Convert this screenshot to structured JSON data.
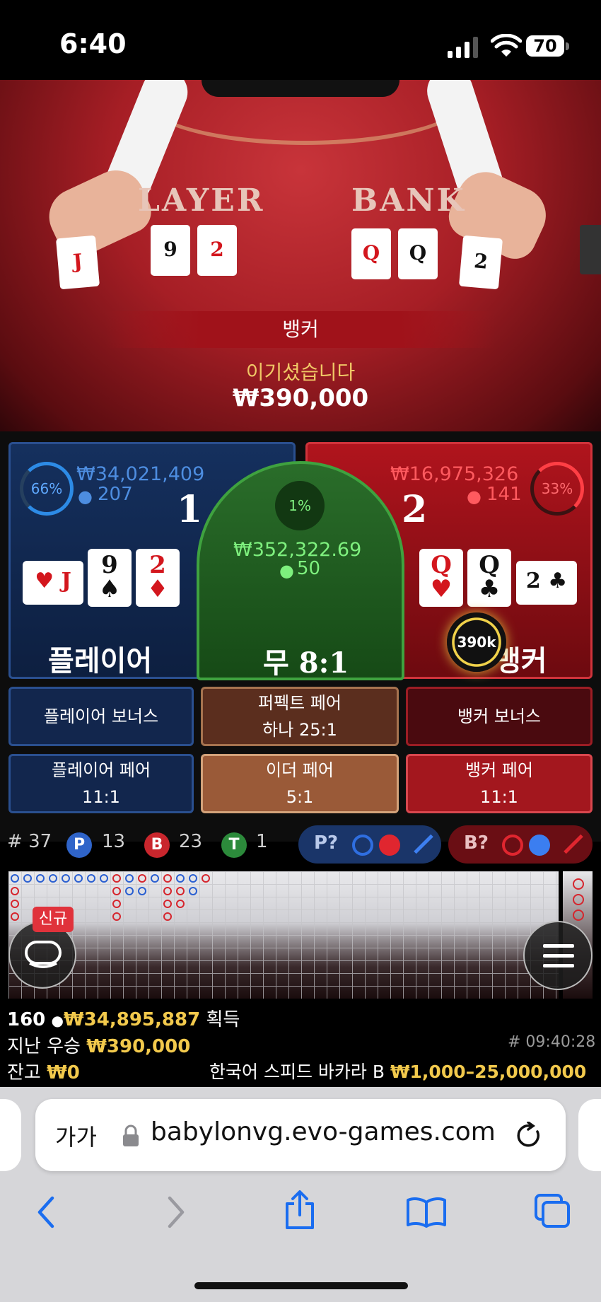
{
  "status_bar": {
    "time": "6:40",
    "battery": "70"
  },
  "video": {
    "table_labels": [
      "LAYER",
      "BANK"
    ],
    "player_cards": [
      "J",
      "9",
      "2"
    ],
    "banker_cards": [
      "Q",
      "Q",
      "2"
    ],
    "result": {
      "winner": "뱅커",
      "message": "이기셨습니다",
      "amount": "₩390,000"
    }
  },
  "player": {
    "percent": "66%",
    "amount": "₩34,021,409",
    "count": "207",
    "score": "1",
    "name": "플레이어",
    "cards": [
      {
        "rank": "J",
        "suit": "♥"
      },
      {
        "rank": "9",
        "suit": "♠"
      },
      {
        "rank": "2",
        "suit": "♦"
      }
    ]
  },
  "tie": {
    "percent": "1%",
    "amount": "₩352,322.69",
    "count": "50",
    "label": "무",
    "odds": "8:1"
  },
  "banker": {
    "percent": "33%",
    "amount": "₩16,975,326",
    "count": "141",
    "score": "2",
    "name": "뱅커",
    "cards": [
      {
        "rank": "Q",
        "suit": "♥"
      },
      {
        "rank": "Q",
        "suit": "♣"
      },
      {
        "rank": "2",
        "suit": "♣"
      }
    ],
    "chip": "390k"
  },
  "side_bets": {
    "player_bonus": "플레이어 보너스",
    "perfect_pair": "퍼펙트 페어",
    "perfect_pair_odds": "하나 25:1",
    "banker_bonus": "뱅커 보너스",
    "player_pair": "플레이어 페어",
    "player_pair_odds": "11:1",
    "either_pair": "이더 페어",
    "either_pair_odds": "5:1",
    "banker_pair": "뱅커 페어",
    "banker_pair_odds": "11:1"
  },
  "stats": {
    "round_label": "#",
    "round": "37",
    "p_label": "P",
    "p": "13",
    "b_label": "B",
    "b": "23",
    "t_label": "T",
    "t": "1",
    "p_predict": "P?",
    "b_predict": "B?"
  },
  "roadmap": {
    "new_badge": "신규"
  },
  "info": {
    "players": "160",
    "won_total": "₩34,895,887",
    "won_label": "획득",
    "last_win_label": "지난 우승",
    "last_win": "₩390,000",
    "time": "# 09:40:28",
    "balance_label": "잔고",
    "balance": "₩0",
    "table_name": "한국어 스피드 바카라 B",
    "limits": "₩1,000–25,000,000"
  },
  "browser": {
    "text_size": "가가",
    "url": "babylonvg.evo-games.com"
  },
  "colors": {
    "player_blue": "#2a4f8f",
    "banker_red": "#d0333b",
    "tie_green": "#3fa23f",
    "gold": "#f2c94c"
  }
}
